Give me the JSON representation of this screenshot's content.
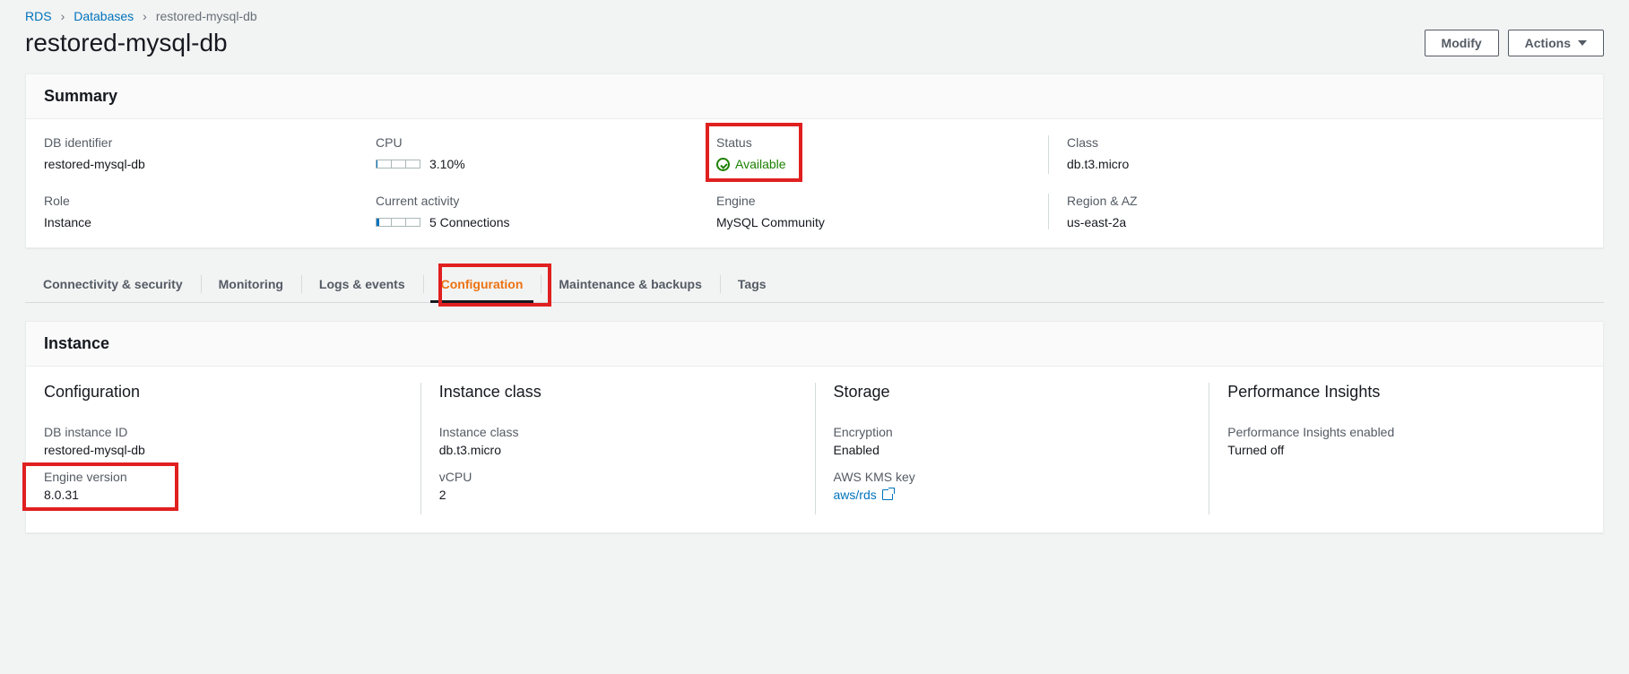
{
  "breadcrumb": {
    "rds": "RDS",
    "databases": "Databases",
    "current": "restored-mysql-db"
  },
  "title": "restored-mysql-db",
  "actions": {
    "modify": "Modify",
    "actions": "Actions"
  },
  "summary": {
    "heading": "Summary",
    "db_identifier": {
      "label": "DB identifier",
      "value": "restored-mysql-db"
    },
    "cpu": {
      "label": "CPU",
      "value": "3.10%",
      "fill_pct": 3.1
    },
    "status": {
      "label": "Status",
      "value": "Available"
    },
    "class": {
      "label": "Class",
      "value": "db.t3.micro"
    },
    "role": {
      "label": "Role",
      "value": "Instance"
    },
    "current_activity": {
      "label": "Current activity",
      "value": "5 Connections",
      "fill_pct": 6
    },
    "engine": {
      "label": "Engine",
      "value": "MySQL Community"
    },
    "region_az": {
      "label": "Region & AZ",
      "value": "us-east-2a"
    }
  },
  "tabs": {
    "connectivity": "Connectivity & security",
    "monitoring": "Monitoring",
    "logs": "Logs & events",
    "configuration": "Configuration",
    "maintenance": "Maintenance & backups",
    "tags": "Tags"
  },
  "instance": {
    "heading": "Instance",
    "configuration": {
      "title": "Configuration",
      "db_instance_id": {
        "label": "DB instance ID",
        "value": "restored-mysql-db"
      },
      "engine_version": {
        "label": "Engine version",
        "value": "8.0.31"
      }
    },
    "instance_class": {
      "title": "Instance class",
      "instance_class": {
        "label": "Instance class",
        "value": "db.t3.micro"
      },
      "vcpu": {
        "label": "vCPU",
        "value": "2"
      }
    },
    "storage": {
      "title": "Storage",
      "encryption": {
        "label": "Encryption",
        "value": "Enabled"
      },
      "kms": {
        "label": "AWS KMS key",
        "value": "aws/rds"
      }
    },
    "pi": {
      "title": "Performance Insights",
      "enabled": {
        "label": "Performance Insights enabled",
        "value": "Turned off"
      }
    }
  }
}
